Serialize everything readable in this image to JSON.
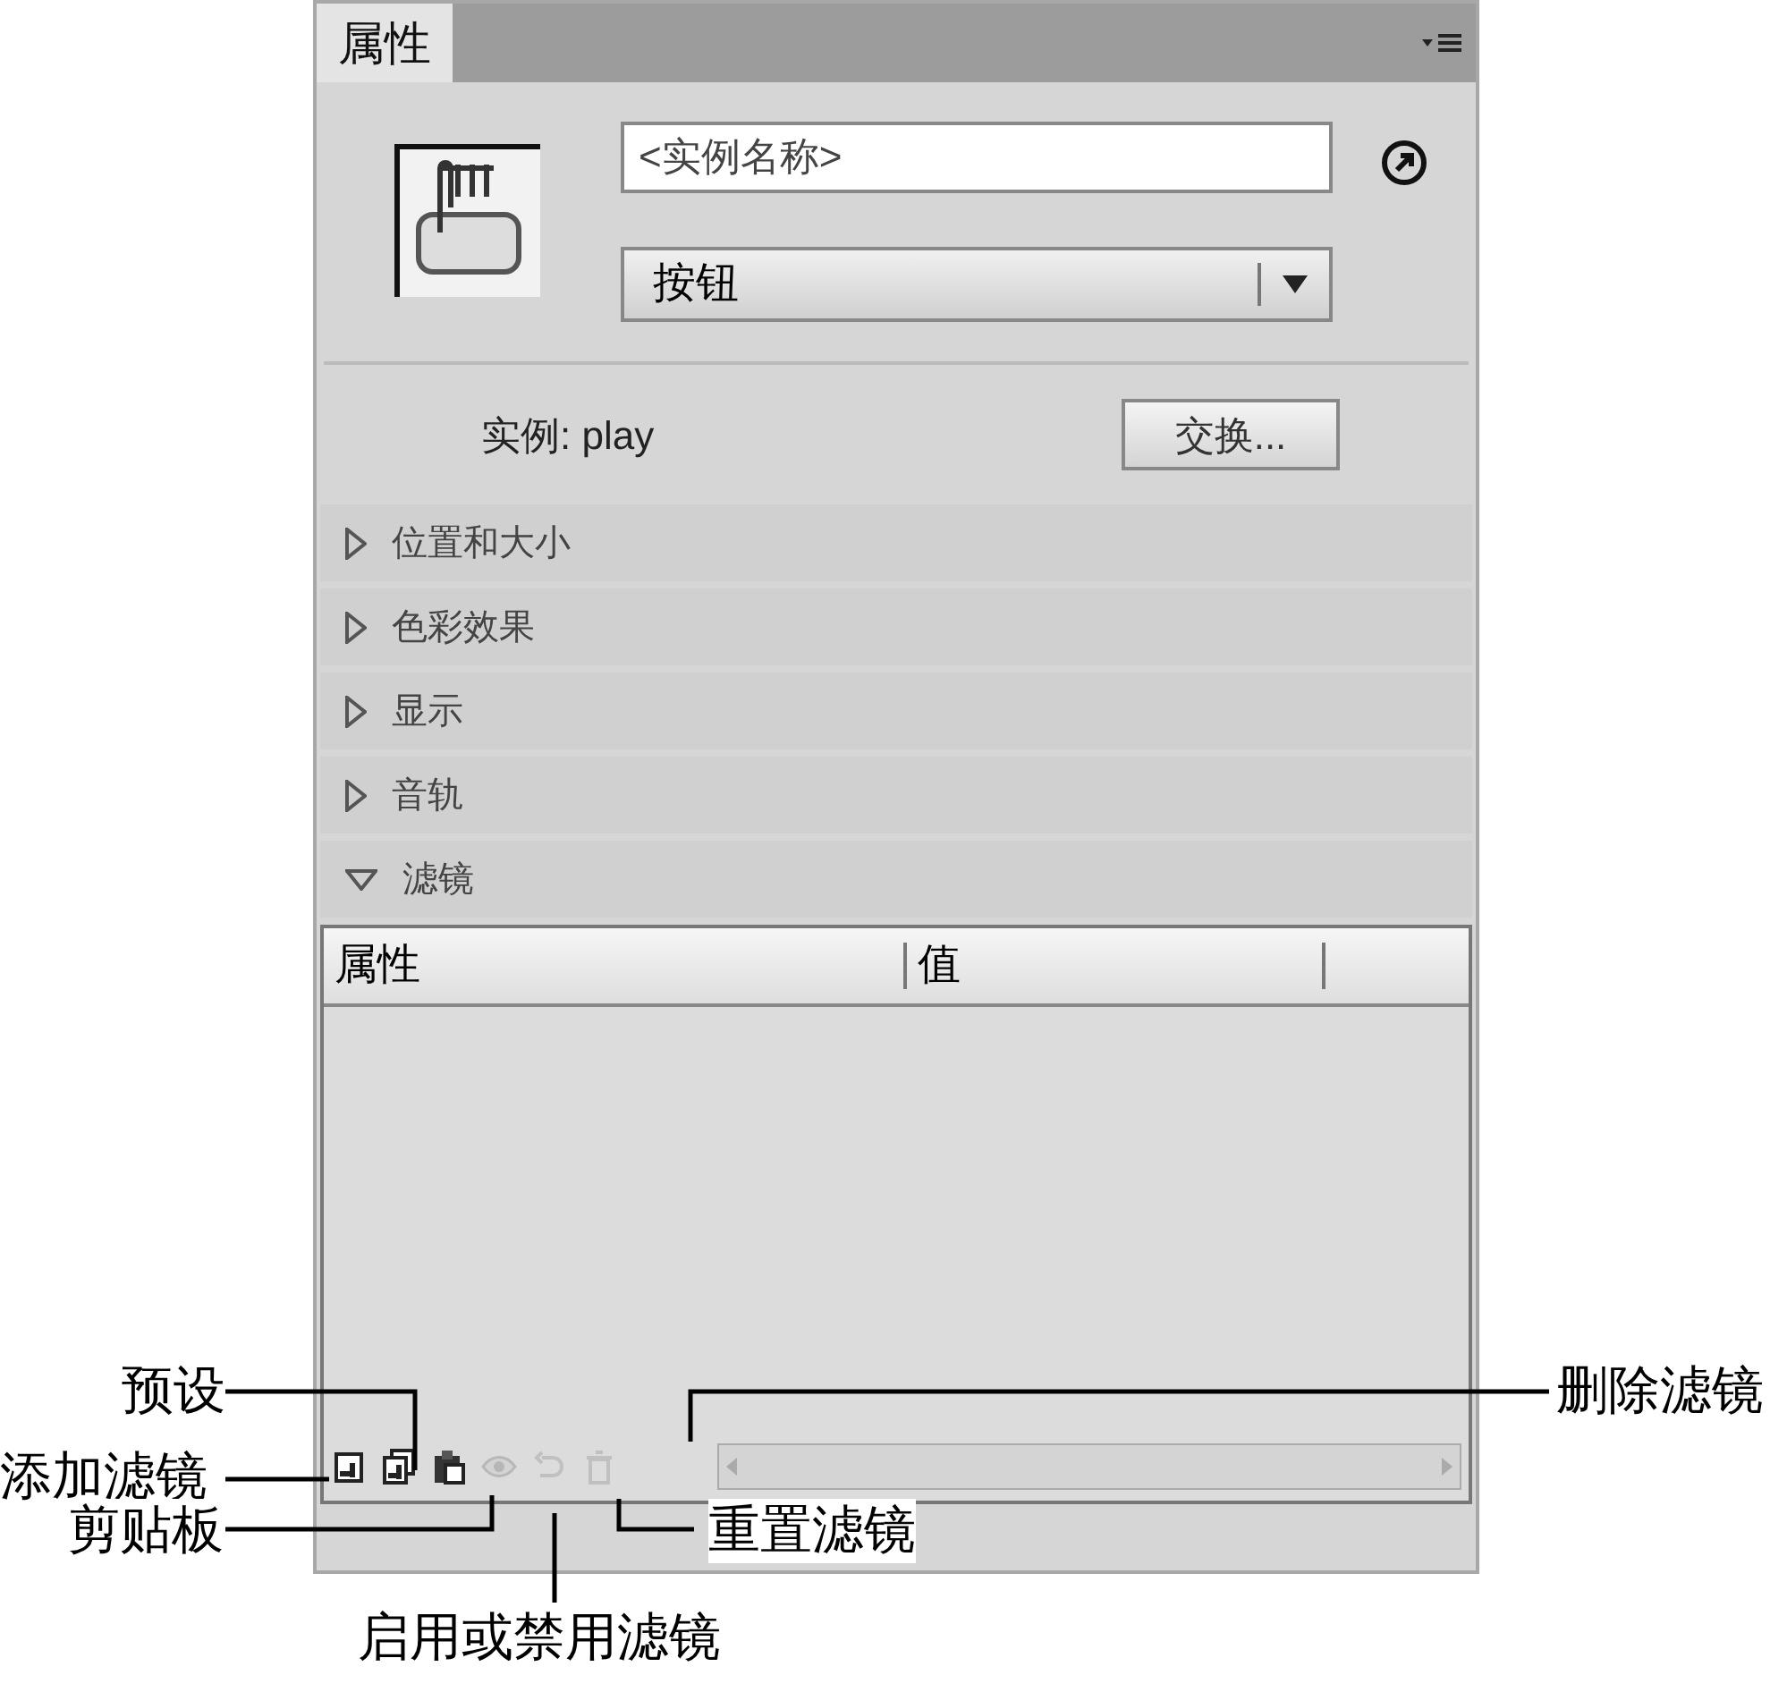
{
  "panel": {
    "tab": {
      "label": "属性",
      "selected": true
    },
    "instance_name": {
      "placeholder": "<实例名称>"
    },
    "type_dropdown": {
      "value": "按钮"
    },
    "instance_label": "实例: play",
    "swap_button": "交换...",
    "sections": [
      {
        "label": "位置和大小",
        "expanded": false
      },
      {
        "label": "色彩效果",
        "expanded": false
      },
      {
        "label": "显示",
        "expanded": false
      },
      {
        "label": "音轨",
        "expanded": false
      },
      {
        "label": "滤镜",
        "expanded": true
      }
    ],
    "filter_table": {
      "columns": [
        "属性",
        "值"
      ]
    },
    "toolbar": [
      {
        "kind": "add",
        "disabled": false
      },
      {
        "kind": "preset",
        "disabled": false
      },
      {
        "kind": "clipboard",
        "disabled": false
      },
      {
        "kind": "toggle",
        "disabled": true
      },
      {
        "kind": "reset",
        "disabled": true
      },
      {
        "kind": "delete",
        "disabled": true
      }
    ]
  },
  "callouts": [
    {
      "text": "预设"
    },
    {
      "text": "添加滤镜"
    },
    {
      "text": "剪贴板"
    },
    {
      "text": "启用或禁用滤镜"
    },
    {
      "text": "重置滤镜"
    },
    {
      "text": "删除滤镜"
    }
  ]
}
